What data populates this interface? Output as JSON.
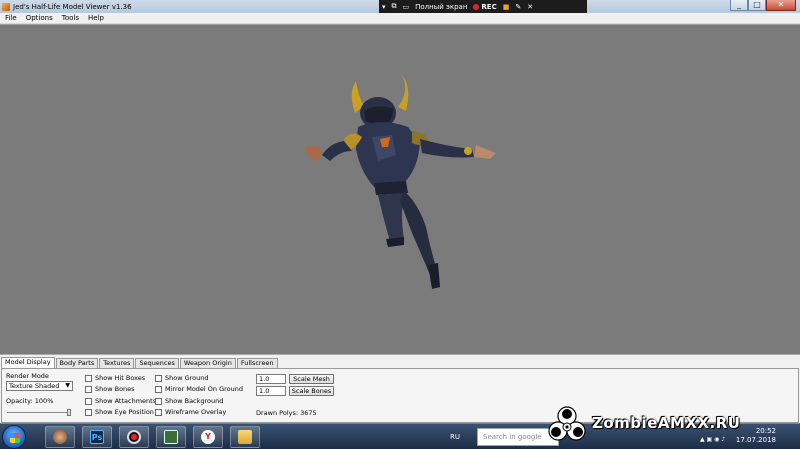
{
  "window": {
    "title": "Jed's Half-Life Model Viewer v1.36",
    "controls": {
      "minimize": "_",
      "maximize": "□",
      "close": "✕"
    }
  },
  "recorder": {
    "fullscreen_label": "Полный экран",
    "rec_label": "REC"
  },
  "menu": {
    "items": [
      "File",
      "Options",
      "Tools",
      "Help"
    ]
  },
  "tabs": [
    "Model Display",
    "Body Parts",
    "Textures",
    "Sequences",
    "Weapon Origin",
    "Fullscreen"
  ],
  "model_display": {
    "render_mode_label": "Render Mode",
    "render_mode_value": "Texture Shaded",
    "opacity_label": "Opacity: 100%",
    "opacity_value": 1.0,
    "checkboxes_col1": [
      "Show Hit Boxes",
      "Show Bones",
      "Show Attachments",
      "Show Eye Position"
    ],
    "checkboxes_col2": [
      "Show Ground",
      "Mirror Model On Ground",
      "Show Background",
      "Wireframe Overlay"
    ],
    "scale_mesh_value": "1.0",
    "scale_mesh_button": "Scale Mesh",
    "scale_bones_value": "1.0",
    "scale_bones_button": "Scale Bones",
    "drawn_polys": "Drawn Polys: 3675"
  },
  "taskbar": {
    "apps": [
      {
        "icon": "photo-icon"
      },
      {
        "icon": "photoshop-icon",
        "glyph": "Ps"
      },
      {
        "icon": "record-icon"
      },
      {
        "icon": "monitor-icon"
      },
      {
        "icon": "yandex-browser-icon",
        "glyph": "Y"
      },
      {
        "icon": "folder-icon"
      }
    ],
    "language": "RU",
    "search_placeholder": "Search in google",
    "time": "20:52",
    "date": "17.07.2018"
  },
  "watermark": {
    "text": "ZombieAMXX.RU"
  },
  "colors": {
    "viewport_bg": "#7b7b7b",
    "panel_bg": "#f0f0f0",
    "taskbar_bg": "#243857"
  }
}
